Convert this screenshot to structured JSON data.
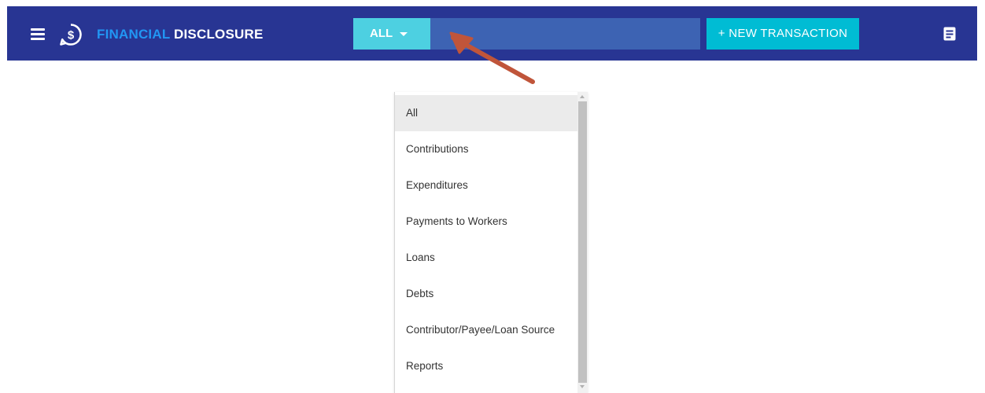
{
  "header": {
    "brand_part1": "FINANCIAL",
    "brand_part2": "DISCLOSURE",
    "filter_value": "ALL",
    "search_value": "",
    "new_transaction_label": "+ NEW TRANSACTION",
    "icons": {
      "menu": "menu-icon",
      "logo": "dollar-chat-icon",
      "caret": "chevron-down-icon",
      "report": "document-icon"
    }
  },
  "dropdown": {
    "items": [
      {
        "label": "All",
        "selected": true
      },
      {
        "label": "Contributions",
        "selected": false
      },
      {
        "label": "Expenditures",
        "selected": false
      },
      {
        "label": "Payments to Workers",
        "selected": false
      },
      {
        "label": "Loans",
        "selected": false
      },
      {
        "label": "Debts",
        "selected": false
      },
      {
        "label": "Contributor/Payee/Loan Source",
        "selected": false
      },
      {
        "label": "Reports",
        "selected": false
      }
    ]
  },
  "colors": {
    "topbar": "#283593",
    "brand_accent": "#2196f3",
    "filter_bg": "#4dd0e1",
    "search_bg": "#3d63b3",
    "button_bg": "#00bcd4",
    "annotation_arrow": "#c0553a",
    "selected_item_bg": "#ebebeb"
  }
}
